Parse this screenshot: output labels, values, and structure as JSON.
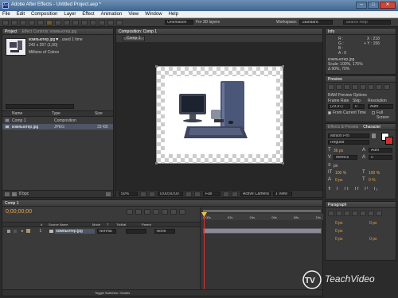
{
  "window": {
    "title": "Adobe After Effects - Untitled Project.aep *"
  },
  "menu": [
    "File",
    "Edit",
    "Composition",
    "Layer",
    "Effect",
    "Animation",
    "View",
    "Window",
    "Help"
  ],
  "toolbar": {
    "for_3d_layers": "For 3D layers",
    "workspace_label": "Workspace:",
    "workspace_value": "Standard",
    "search_placeholder": "Search Help",
    "view_mode": "Orientation"
  },
  "project": {
    "tab": "Project",
    "tab2": "Effect Controls: компьютер.jpg",
    "file_name": "компьютер.jpg▼",
    "used": ", used 1 time",
    "dims": "242 x 257 (1,00)",
    "colors": "Millions of Colors",
    "search_placeholder": "",
    "columns": [
      "Name",
      "Type",
      "Size"
    ],
    "items": [
      {
        "name": "Comp 1",
        "type": "Composition",
        "size": ""
      },
      {
        "name": "компьютер.jpg",
        "type": "JPEG",
        "size": "33 KB"
      }
    ],
    "bpc": "8 bpc"
  },
  "comp_viewer": {
    "tab": "Composition: Comp 1",
    "breadcrumb": "Comp 1",
    "zoom": "50%",
    "timecode": "0;00;00;00",
    "quality": "Full",
    "camera": "Active Camera",
    "views": "1 View"
  },
  "info": {
    "tab": "Info",
    "r": "R :",
    "g": "G :",
    "b": "B :",
    "a": "A : 0",
    "x": "X : 218",
    "y": "+ Y : 156",
    "file": "компьютер.jpg",
    "scale": "Scale: 100%, 175%",
    "pos": "Δ 90%, 70%"
  },
  "preview": {
    "tab": "Preview",
    "options": "RAM Preview Options",
    "frame_rate_label": "Frame Rate",
    "skip_label": "Skip",
    "resolution_label": "Resolution",
    "frame_rate": "(29,97)",
    "skip": "0",
    "resolution": "Auto",
    "from_current": "From Current Time",
    "full_screen": "Full Screen"
  },
  "character": {
    "tab1": "Effects & Presets",
    "tab2": "Character",
    "font": "Minion Pro",
    "style": "Regular",
    "size": "36 px",
    "leading": "Auto",
    "kerning": "Metrics",
    "tracking": "0",
    "unit": "px",
    "scale_v": "100 %",
    "scale_h": "100 %",
    "baseline": "0 px",
    "tsume": "0 %",
    "styles": [
      "T",
      "T",
      "TT",
      "Tт",
      "T¹",
      "T₁"
    ]
  },
  "paragraph": {
    "tab": "Paragraph",
    "values": [
      "0 px",
      "0 px",
      "0 px",
      "0 px",
      "0 px"
    ]
  },
  "timeline": {
    "tab": "Comp 1",
    "timecode": "0;00;00;00",
    "columns": [
      "#",
      "Source Name",
      "Mode",
      "T",
      "TrkMat",
      "Parent"
    ],
    "layers": [
      {
        "num": "1",
        "name": "компьютер.jpg",
        "mode": "Normal",
        "parent": "None"
      }
    ],
    "ruler": [
      "0:00s",
      "02s",
      "04s",
      "06s",
      "08s",
      "10s"
    ],
    "toggle": "Toggle Switches / Modes"
  },
  "watermark": "TeachVideo"
}
